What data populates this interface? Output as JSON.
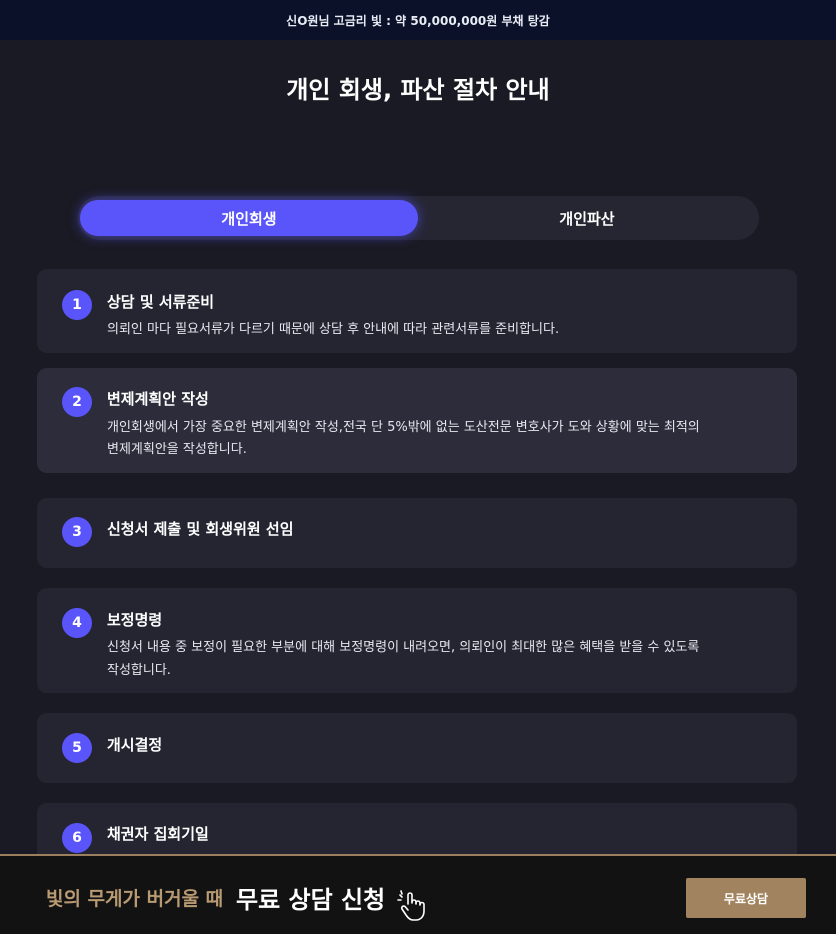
{
  "topbar": {
    "text": "신O원님 고금리 빛 : 약 50,000,000원 부채 탕감"
  },
  "page": {
    "title": "개인 회생, 파산 절차 안내"
  },
  "tabs": [
    {
      "label": "개인회생",
      "active": true
    },
    {
      "label": "개인파산",
      "active": false
    }
  ],
  "steps": [
    {
      "number": "1",
      "title": "상담 및 서류준비",
      "description": "의뢰인 마다 필요서류가 다르기 때문에 상담 후 안내에 따라 관련서류를 준비합니다."
    },
    {
      "number": "2",
      "title": "변제계획안 작성",
      "description_line1": "개인회생에서 가장 중요한 변제계획안 작성,전국 단 5%밖에 없는 도산전문 변호사가 도와 상황에 맞는 최적의",
      "description_line2": "변제계획안을 작성합니다."
    },
    {
      "number": "3",
      "title": "신청서 제출 및 회생위원 선임"
    },
    {
      "number": "4",
      "title": "보정명령",
      "description_line1": "신청서 내용 중 보정이 필요한 부분에 대해 보정명령이 내려오면, 의뢰인이 최대한 많은 혜택을 받을 수 있도록",
      "description_line2": "작성합니다."
    },
    {
      "number": "5",
      "title": "개시결정"
    },
    {
      "number": "6",
      "title": "채권자 집회기일"
    }
  ],
  "bottom_bar": {
    "subtitle": "빛의 무게가 버거울 때",
    "headline": "무료 상담 신청",
    "button_label": "무료상담",
    "icon": "pointing-hand-icon"
  },
  "colors": {
    "accent": "#5a55fb",
    "gold": "#a1845f",
    "background": "#1a1a24",
    "card": "#252532",
    "topbar": "#0a1128"
  }
}
